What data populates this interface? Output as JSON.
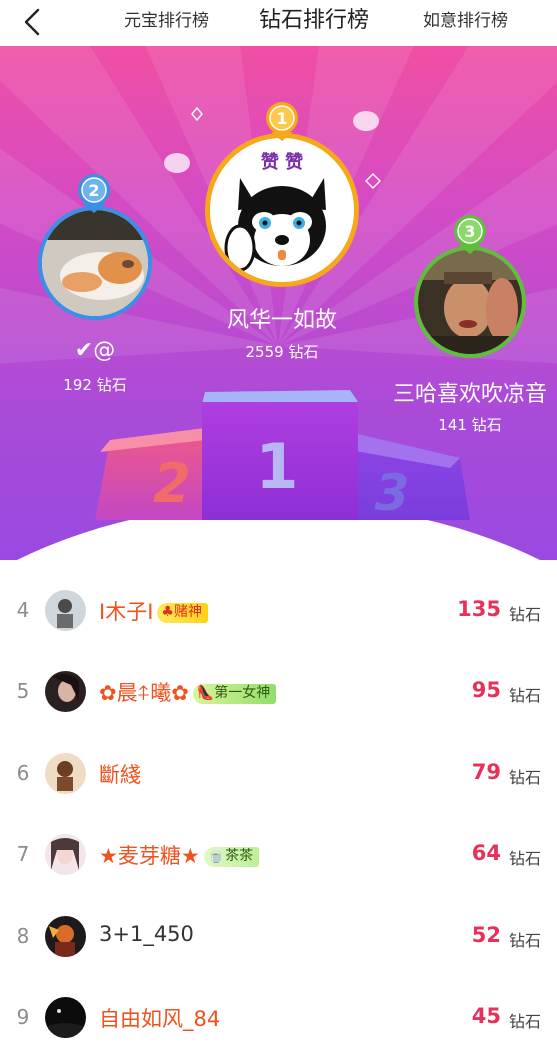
{
  "header": {
    "tabs": [
      "元宝排行榜",
      "钻石排行榜",
      "如意排行榜"
    ],
    "active_tab": "钻石排行榜"
  },
  "podium": {
    "first": {
      "rank_badge": "1",
      "name": "风华一如故",
      "score": "2559 钻石",
      "medal_color": "#f6a81a"
    },
    "second": {
      "rank_badge": "2",
      "name": "✔@",
      "score": "192 钻石",
      "medal_color": "#3a8fe6"
    },
    "third": {
      "rank_badge": "3",
      "name": "三哈喜欢吹凉音",
      "score": "141 钻石",
      "medal_color": "#5fbf3c"
    },
    "step_labels": [
      "2",
      "1",
      "3"
    ]
  },
  "ranking": [
    {
      "rank": "4",
      "name": "I木子I",
      "badge": "♣赌神",
      "badge_style": "yellow",
      "score": "135",
      "unit": "钻石"
    },
    {
      "rank": "5",
      "name": "✿晨⍏曦✿",
      "badge": "👠第一女神",
      "badge_style": "green",
      "score": "95",
      "unit": "钻石"
    },
    {
      "rank": "6",
      "name": "斷綫",
      "badge": "",
      "badge_style": "",
      "score": "79",
      "unit": "钻石"
    },
    {
      "rank": "7",
      "name": "★麦芽糖★",
      "badge": "🍵茶茶",
      "badge_style": "lightgreen",
      "score": "64",
      "unit": "钻石"
    },
    {
      "rank": "8",
      "name": "3+1_450",
      "badge": "",
      "badge_style": "",
      "score": "52",
      "unit": "钻石"
    },
    {
      "rank": "9",
      "name": "自由如风_84",
      "badge": "",
      "badge_style": "",
      "score": "45",
      "unit": "钻石"
    }
  ],
  "colors": {
    "accent": "#e8315a",
    "name_orange": "#f0521e",
    "hero_pink": "#f04fa3",
    "hero_purple": "#9a49e0"
  }
}
